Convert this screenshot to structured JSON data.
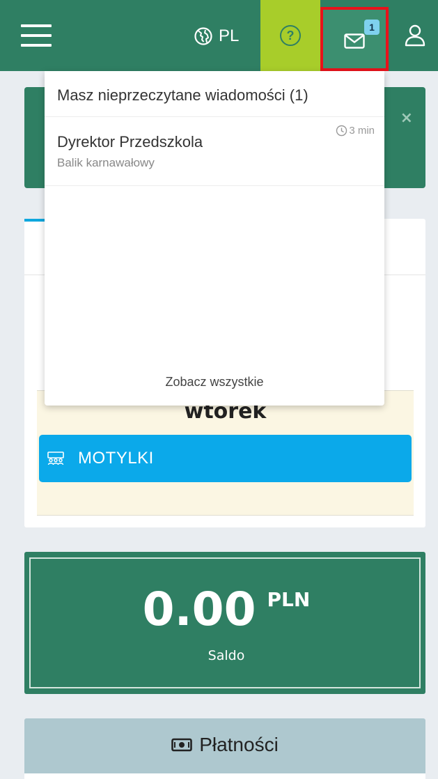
{
  "header": {
    "language": "PL",
    "unread_badge": "1"
  },
  "messages_dropdown": {
    "title": "Masz nieprzeczytane wiadomości (1)",
    "items": [
      {
        "sender": "Dyrektor Przedszkola",
        "subject": "Balik karnawałowy",
        "time": "3 min"
      }
    ],
    "see_all": "Zobacz wszystkie"
  },
  "alert": {
    "close": "×"
  },
  "schedule": {
    "day": "wtorek",
    "group": "MOTYLKI"
  },
  "balance": {
    "amount": "0.00",
    "currency": "PLN",
    "label": "Saldo"
  },
  "payments": {
    "title": "Płatności"
  },
  "icons": {
    "menu": "hamburger-icon",
    "language": "globe-icon",
    "help": "question-circle-icon",
    "messages": "envelope-icon",
    "account": "user-icon",
    "time": "clock-icon",
    "group": "group-icon",
    "payments": "money-icon"
  },
  "colors": {
    "brand_green": "#2f7f63",
    "help_lime": "#a8cd2a",
    "group_blue": "#0ba9ea",
    "highlight_red": "#e8121b"
  }
}
